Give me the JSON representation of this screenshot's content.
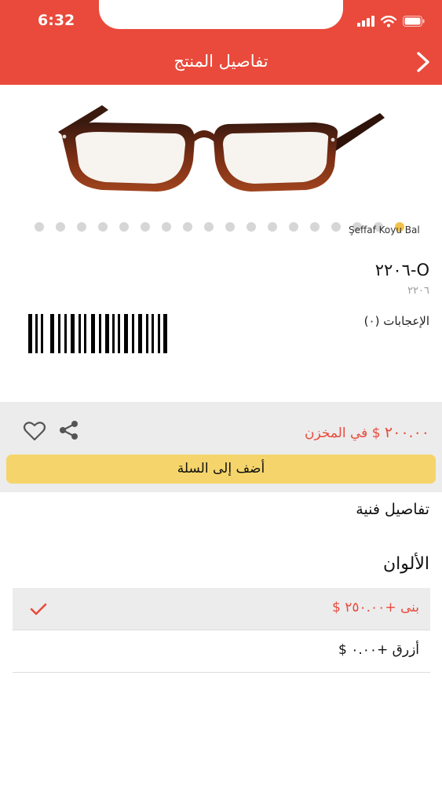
{
  "status_bar": {
    "time": "6:32",
    "icons": [
      "signal-icon",
      "wifi-icon",
      "battery-icon"
    ]
  },
  "nav": {
    "title": "تفاصيل المنتج",
    "back_icon": "chevron-back-icon"
  },
  "product": {
    "image_icon": "eyeglasses-image",
    "color_caption": "Şeffaf Koyu Bal",
    "pager": {
      "count": 18,
      "active_index": 17
    },
    "name": "O-٢٢٠٦",
    "code": "٢٢٠٦",
    "likes_label": "الإعجابات (٠)",
    "barcode_icon": "barcode-image"
  },
  "purchase": {
    "price_value": "٢٠٠.٠٠",
    "currency": "$",
    "stock_label": "في المخزن",
    "add_to_cart": "أضف إلى السلة",
    "share_icon": "share-icon",
    "like_icon": "heart-icon"
  },
  "sections": {
    "technical_details": "تفاصيل فنية",
    "colors_title": "الألوان"
  },
  "colors": [
    {
      "label": "بنى +٢٥٠.٠٠ $",
      "selected": true
    },
    {
      "label": "أزرق +٠.٠٠ $",
      "selected": false
    }
  ],
  "theme": {
    "accent": "#e94a3b",
    "cart_button": "#f5d56b",
    "panel": "#ececec",
    "pager_active": "#f0c24b"
  }
}
